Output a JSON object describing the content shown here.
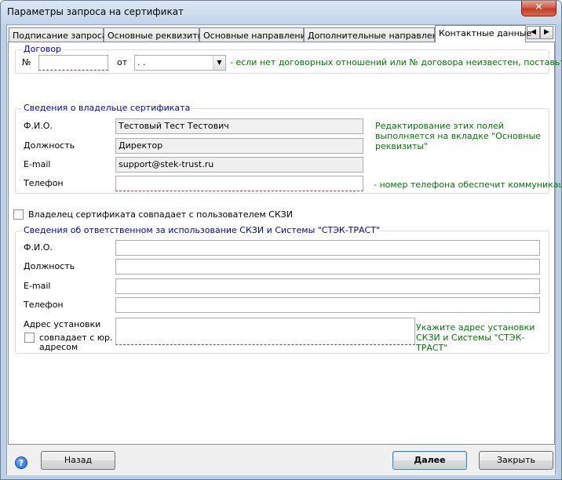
{
  "window": {
    "title": "Параметры запроса на сертификат",
    "close_glyph": "✕"
  },
  "tabs": [
    {
      "label": "Подписание запроса"
    },
    {
      "label": "Основные реквизиты"
    },
    {
      "label": "Основные направления"
    },
    {
      "label": "Дополнительные направления"
    },
    {
      "label": "Контактные данные"
    }
  ],
  "tab_scroll": {
    "left": "◀",
    "right": "▶"
  },
  "contract": {
    "group_title": "Договор",
    "number_label": "№",
    "number_value": "",
    "date_label": "от",
    "date_value": " .  .",
    "hint": "- если нет договорных отношений или № договора неизвестен, поставьте \"б/н\""
  },
  "owner": {
    "group_title": "Сведения о владельце сертификата",
    "fio_label": "Ф.И.О.",
    "fio_value": "Тестовый Тест Тестович",
    "position_label": "Должность",
    "position_value": "Директор",
    "email_label": "E-mail",
    "email_value": "support@stek-trust.ru",
    "phone_label": "Телефон",
    "phone_value": "",
    "edit_note": "Редактирование этих полей выполняется на вкладке \"Основные реквизиты\"",
    "phone_hint": "- номер телефона обеспечит коммуникации"
  },
  "same_user_checkbox": {
    "label": "Владелец сертификата совпадает с пользователем СКЗИ",
    "checked": false
  },
  "responsible": {
    "group_title": "Сведения об ответственном за использование СКЗИ и Системы \"СТЭК-ТРАСТ\"",
    "fio_label": "Ф.И.О.",
    "fio_value": "",
    "position_label": "Должность",
    "position_value": "",
    "email_label": "E-mail",
    "email_value": "",
    "phone_label": "Телефон",
    "phone_value": "",
    "address_label": "Адрес установки",
    "address_value": "",
    "same_address_label_line1": "совпадает с юр.",
    "same_address_label_line2": "адресом",
    "same_address_checked": false,
    "address_hint": "Укажите адрес установки СКЗИ и Системы \"СТЭК-ТРАСТ\""
  },
  "buttons": {
    "help": "?",
    "back": "Назад",
    "next": "Далее",
    "close": "Закрыть"
  }
}
